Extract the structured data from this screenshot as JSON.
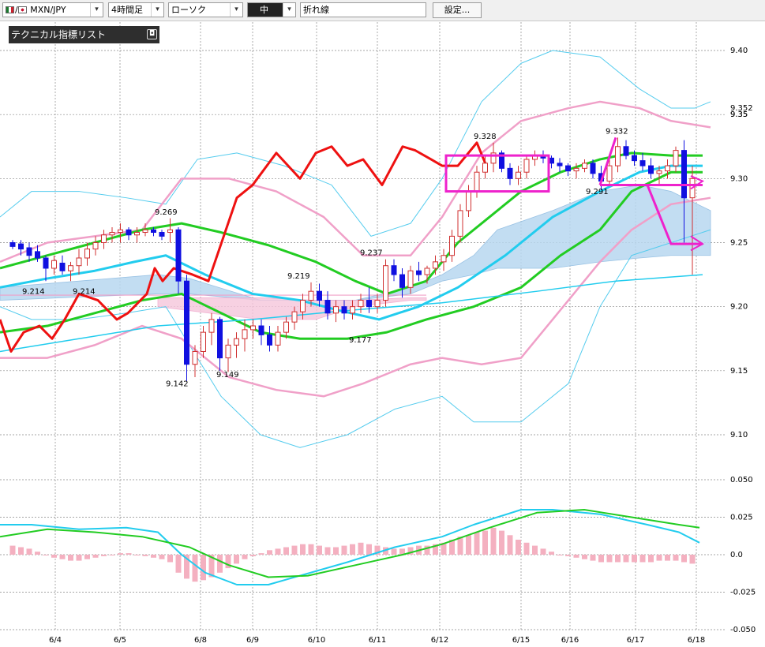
{
  "toolbar": {
    "pair": "MXN/JPY",
    "pair_separator": "/",
    "timeframe": "4時間足",
    "chart_style": "ローソク",
    "size": "中",
    "line_mode": "折れ線",
    "settings_label": "設定..."
  },
  "indicator_panel": {
    "title": "テクニカル指標リスト",
    "close_glyph": "◘"
  },
  "colors": {
    "bull_candle": "#d03030",
    "bear_candle": "#1010e0",
    "grid": "#888888",
    "ma_short": "#22cc22",
    "ma_long": "#22ccee",
    "bollinger_inner": "#f0a0c8",
    "bollinger_outer": "#55ccee",
    "rsi_line": "#ee1111",
    "cloud": "#b8d8f0",
    "annotation": "#ee22cc",
    "macd_hist": "#f4b0c0"
  },
  "chart_data": {
    "type": "candlestick",
    "pair": "MXN/JPY",
    "timeframe": "4時間足",
    "price_axis": {
      "ylim": [
        9.1,
        9.4
      ],
      "ticks": [
        "9.40",
        "9.35",
        "9.30",
        "9.25",
        "9.20",
        "9.15",
        "9.10"
      ],
      "extra_labels": [
        "9.352",
        "9.35"
      ]
    },
    "macd_axis": {
      "ylim": [
        -0.05,
        0.05
      ],
      "ticks": [
        "0.050",
        "0.025",
        "0.0",
        "-0.025",
        "-0.050"
      ]
    },
    "x_axis": {
      "ticks": [
        "6/4",
        "6/5",
        "6/8",
        "6/9",
        "6/10",
        "6/11",
        "6/12",
        "6/15",
        "6/16",
        "6/17",
        "6/18"
      ]
    },
    "annotations": [
      "9.214",
      "9.214",
      "9.269",
      "9.142",
      "9.149",
      "9.219",
      "9.237",
      "9.177",
      "9.328",
      "9.332",
      "9.291"
    ],
    "candles": [
      [
        9.25,
        9.252,
        9.245,
        9.247
      ],
      [
        9.249,
        9.252,
        9.24,
        9.245
      ],
      [
        9.246,
        9.25,
        9.235,
        9.24
      ],
      [
        9.243,
        9.248,
        9.235,
        9.238
      ],
      [
        9.238,
        9.24,
        9.22,
        9.23
      ],
      [
        9.23,
        9.24,
        9.225,
        9.236
      ],
      [
        9.234,
        9.24,
        9.225,
        9.228
      ],
      [
        9.228,
        9.235,
        9.22,
        9.232
      ],
      [
        9.232,
        9.245,
        9.225,
        9.238
      ],
      [
        9.238,
        9.25,
        9.232,
        9.245
      ],
      [
        9.245,
        9.255,
        9.24,
        9.25
      ],
      [
        9.25,
        9.26,
        9.245,
        9.256
      ],
      [
        9.256,
        9.262,
        9.25,
        9.258
      ],
      [
        9.258,
        9.265,
        9.25,
        9.26
      ],
      [
        9.26,
        9.262,
        9.252,
        9.256
      ],
      [
        9.256,
        9.262,
        9.25,
        9.258
      ],
      [
        9.258,
        9.265,
        9.255,
        9.26
      ],
      [
        9.26,
        9.262,
        9.255,
        9.258
      ],
      [
        9.258,
        9.26,
        9.252,
        9.255
      ],
      [
        9.258,
        9.269,
        9.25,
        9.26
      ],
      [
        9.26,
        9.262,
        9.21,
        9.22
      ],
      [
        9.22,
        9.225,
        9.142,
        9.155
      ],
      [
        9.155,
        9.17,
        9.145,
        9.165
      ],
      [
        9.165,
        9.185,
        9.16,
        9.18
      ],
      [
        9.18,
        9.195,
        9.17,
        9.19
      ],
      [
        9.19,
        9.192,
        9.15,
        9.16
      ],
      [
        9.16,
        9.175,
        9.149,
        9.17
      ],
      [
        9.17,
        9.18,
        9.16,
        9.175
      ],
      [
        9.175,
        9.19,
        9.165,
        9.182
      ],
      [
        9.182,
        9.19,
        9.175,
        9.185
      ],
      [
        9.185,
        9.19,
        9.17,
        9.178
      ],
      [
        9.178,
        9.185,
        9.165,
        9.17
      ],
      [
        9.17,
        9.185,
        9.165,
        9.18
      ],
      [
        9.18,
        9.192,
        9.175,
        9.188
      ],
      [
        9.188,
        9.2,
        9.182,
        9.196
      ],
      [
        9.196,
        9.21,
        9.19,
        9.205
      ],
      [
        9.205,
        9.219,
        9.2,
        9.212
      ],
      [
        9.212,
        9.218,
        9.2,
        9.205
      ],
      [
        9.205,
        9.212,
        9.19,
        9.195
      ],
      [
        9.195,
        9.205,
        9.188,
        9.2
      ],
      [
        9.2,
        9.205,
        9.19,
        9.195
      ],
      [
        9.195,
        9.205,
        9.19,
        9.2
      ],
      [
        9.2,
        9.21,
        9.195,
        9.205
      ],
      [
        9.205,
        9.215,
        9.195,
        9.2
      ],
      [
        9.2,
        9.21,
        9.195,
        9.205
      ],
      [
        9.205,
        9.237,
        9.2,
        9.232
      ],
      [
        9.232,
        9.237,
        9.22,
        9.225
      ],
      [
        9.225,
        9.23,
        9.207,
        9.215
      ],
      [
        9.215,
        9.232,
        9.21,
        9.228
      ],
      [
        9.228,
        9.235,
        9.22,
        9.225
      ],
      [
        9.225,
        9.232,
        9.218,
        9.23
      ],
      [
        9.23,
        9.24,
        9.225,
        9.235
      ],
      [
        9.235,
        9.245,
        9.228,
        9.24
      ],
      [
        9.24,
        9.26,
        9.235,
        9.255
      ],
      [
        9.255,
        9.28,
        9.25,
        9.275
      ],
      [
        9.275,
        9.295,
        9.27,
        9.29
      ],
      [
        9.29,
        9.31,
        9.285,
        9.305
      ],
      [
        9.305,
        9.318,
        9.3,
        9.312
      ],
      [
        9.312,
        9.328,
        9.305,
        9.32
      ],
      [
        9.32,
        9.322,
        9.305,
        9.308
      ],
      [
        9.308,
        9.312,
        9.295,
        9.3
      ],
      [
        9.3,
        9.31,
        9.295,
        9.305
      ],
      [
        9.305,
        9.318,
        9.3,
        9.315
      ],
      [
        9.315,
        9.322,
        9.31,
        9.318
      ],
      [
        9.318,
        9.322,
        9.312,
        9.316
      ],
      [
        9.316,
        9.318,
        9.308,
        9.312
      ],
      [
        9.312,
        9.316,
        9.305,
        9.31
      ],
      [
        9.31,
        9.312,
        9.302,
        9.306
      ],
      [
        9.306,
        9.312,
        9.3,
        9.308
      ],
      [
        9.308,
        9.315,
        9.305,
        9.312
      ],
      [
        9.312,
        9.315,
        9.3,
        9.304
      ],
      [
        9.304,
        9.31,
        9.291,
        9.298
      ],
      [
        9.298,
        9.315,
        9.295,
        9.31
      ],
      [
        9.31,
        9.332,
        9.305,
        9.325
      ],
      [
        9.325,
        9.33,
        9.315,
        9.318
      ],
      [
        9.318,
        9.322,
        9.31,
        9.314
      ],
      [
        9.314,
        9.32,
        9.306,
        9.31
      ],
      [
        9.31,
        9.316,
        9.3,
        9.304
      ],
      [
        9.304,
        9.31,
        9.295,
        9.306
      ],
      [
        9.306,
        9.315,
        9.3,
        9.31
      ],
      [
        9.31,
        9.325,
        9.305,
        9.322
      ],
      [
        9.322,
        9.33,
        9.25,
        9.285
      ],
      [
        9.285,
        9.31,
        9.225,
        9.3
      ]
    ],
    "macd_hist": [
      0.006,
      0.005,
      0.004,
      0.002,
      0.0,
      -0.002,
      -0.003,
      -0.004,
      -0.004,
      -0.003,
      -0.002,
      -0.001,
      0.0,
      0.001,
      0.001,
      0.0,
      -0.001,
      -0.002,
      -0.003,
      -0.005,
      -0.012,
      -0.016,
      -0.018,
      -0.017,
      -0.015,
      -0.012,
      -0.009,
      -0.006,
      -0.003,
      -0.001,
      0.001,
      0.003,
      0.004,
      0.005,
      0.006,
      0.007,
      0.007,
      0.006,
      0.005,
      0.005,
      0.006,
      0.007,
      0.008,
      0.007,
      0.006,
      0.005,
      0.004,
      0.004,
      0.005,
      0.006,
      0.006,
      0.007,
      0.008,
      0.01,
      0.012,
      0.013,
      0.015,
      0.016,
      0.018,
      0.016,
      0.013,
      0.01,
      0.008,
      0.006,
      0.004,
      0.002,
      0.0,
      -0.001,
      -0.002,
      -0.003,
      -0.004,
      -0.005,
      -0.005,
      -0.005,
      -0.005,
      -0.005,
      -0.005,
      -0.005,
      -0.004,
      -0.004,
      -0.004,
      -0.005,
      -0.006
    ]
  }
}
